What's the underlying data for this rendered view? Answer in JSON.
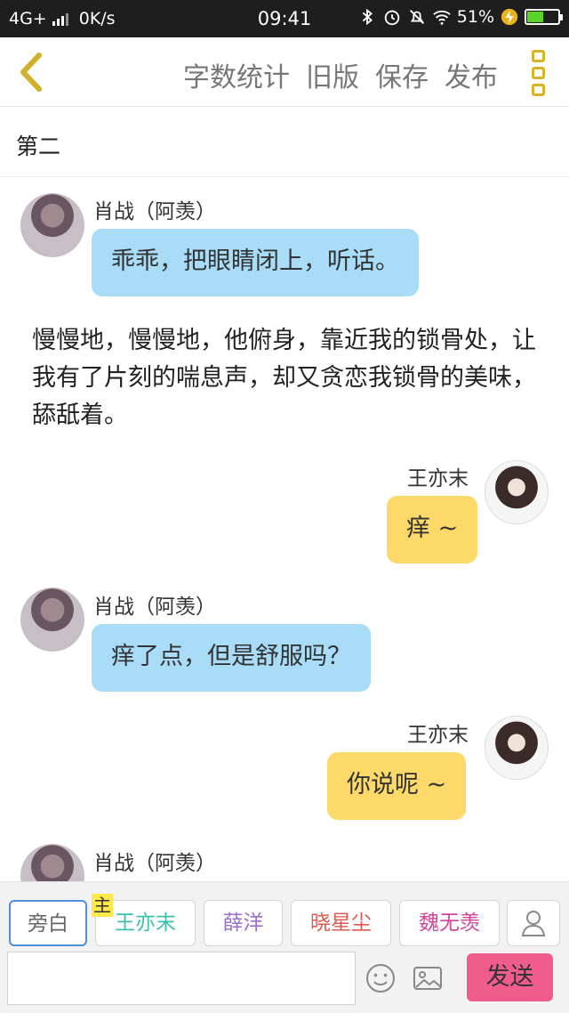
{
  "status_bar": {
    "network": "4G+",
    "speed": "0K/s",
    "time": "09:41",
    "battery": "51%",
    "icons": [
      "bluetooth-icon",
      "alarm-icon",
      "mute-icon",
      "wifi-icon",
      "charging-icon"
    ]
  },
  "toolbar": {
    "back_icon": "chevron-left-icon",
    "actions": [
      "字数统计",
      "旧版",
      "保存",
      "发布"
    ],
    "more_icon": "more-vertical-icon"
  },
  "chapter_title": "第二",
  "messages": [
    {
      "type": "left",
      "name": "肖战（阿羡）",
      "text": "乖乖，把眼睛闭上，听话。"
    },
    {
      "type": "narration",
      "text": "慢慢地，慢慢地，他俯身，靠近我的锁骨处，让我有了片刻的喘息声，却又贪恋我锁骨的美味，舔舐着。"
    },
    {
      "type": "right",
      "name": "王亦末",
      "text": "痒 ~"
    },
    {
      "type": "left",
      "name": "肖战（阿羡）",
      "text": "痒了点，但是舒服吗？"
    },
    {
      "type": "right",
      "name": "王亦末",
      "text": "你说呢 ~"
    },
    {
      "type": "left",
      "name": "肖战（阿羡）",
      "text": ""
    }
  ],
  "roles": {
    "main_badge": "主",
    "chips": [
      {
        "label": "旁白",
        "color": "#666666"
      },
      {
        "label": "王亦末",
        "color": "#3fbfae"
      },
      {
        "label": "薛洋",
        "color": "#9b6fd0"
      },
      {
        "label": "晓星尘",
        "color": "#e0584f"
      },
      {
        "label": "魏无羡",
        "color": "#d2469a"
      }
    ],
    "person_icon": "person-icon"
  },
  "composer": {
    "input_value": "",
    "emoji_icon": "emoji-icon",
    "image_icon": "image-icon",
    "send_label": "发送",
    "send_color": "#f05d8c"
  }
}
